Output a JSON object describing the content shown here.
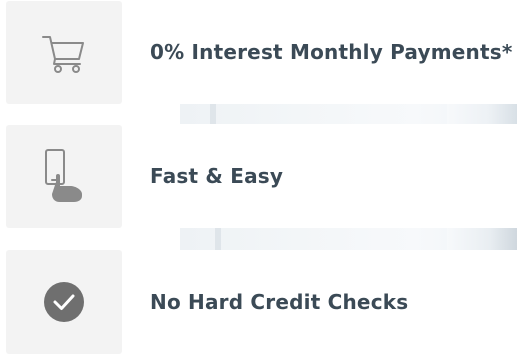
{
  "features": [
    {
      "label": "0% Interest Monthly Payments*",
      "icon": "shopping-cart-icon"
    },
    {
      "label": "Fast & Easy",
      "icon": "phone-tap-hand-icon"
    },
    {
      "label": "No Hard Credit Checks",
      "icon": "checkmark-circle-icon"
    }
  ],
  "colors": {
    "text": "#3b4a56",
    "tile": "#f3f3f3",
    "icon": "#8a8a8a",
    "check_circle": "#6f6f6f"
  }
}
